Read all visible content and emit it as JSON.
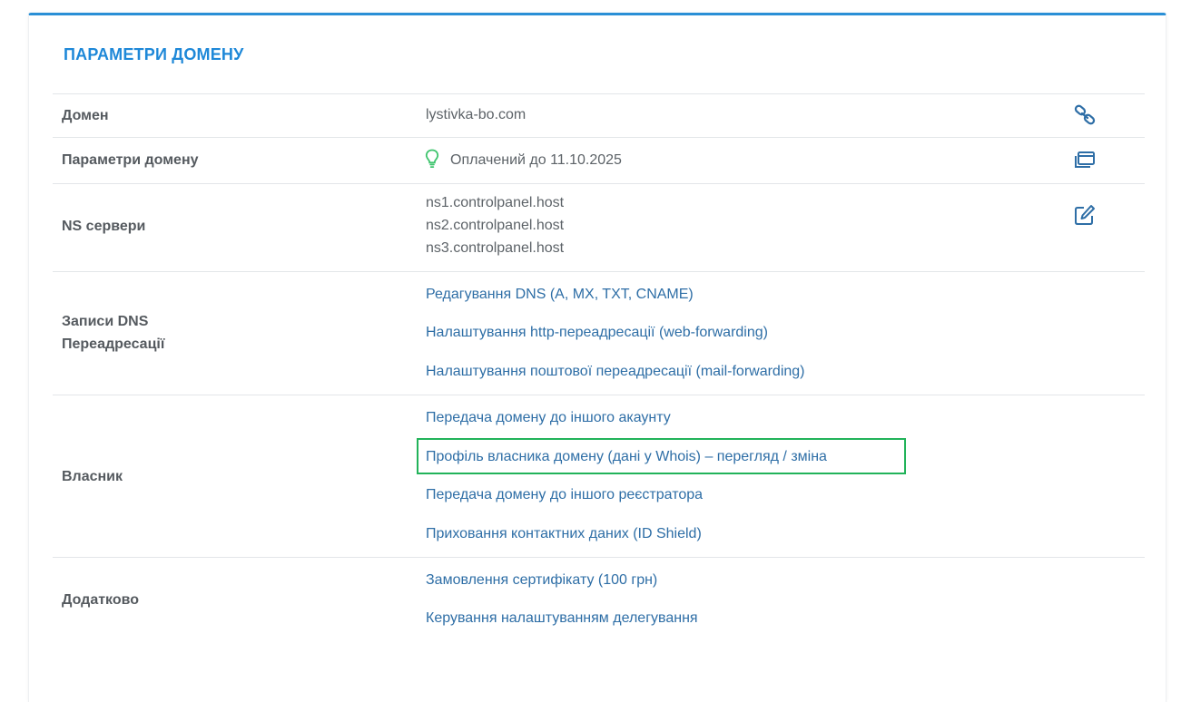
{
  "panel": {
    "title": "ПАРАМЕТРИ ДОМЕНУ"
  },
  "rows": {
    "domain": {
      "label": "Домен",
      "value": "lystivka-bo.com",
      "icon": "link-icon"
    },
    "params": {
      "label": "Параметри домену",
      "value": "Оплачений до 11.10.2025",
      "status_icon": "lightbulb-icon",
      "icon": "windows-icon"
    },
    "ns": {
      "label": "NS сервери",
      "servers": [
        "ns1.controlpanel.host",
        "ns2.controlpanel.host",
        "ns3.controlpanel.host"
      ],
      "icon": "edit-icon"
    },
    "dns": {
      "label_line1": "Записи DNS",
      "label_line2": "Переадресації",
      "links": [
        "Редагування DNS (A, MX, TXT, CNAME)",
        "Налаштування http-переадресації (web-forwarding)",
        "Налаштування поштової переадресації (mail-forwarding)"
      ]
    },
    "owner": {
      "label": "Власник",
      "links": [
        "Передача домену до іншого акаунту",
        "Профіль власника домену (дані у Whois) – перегляд / зміна",
        "Передача домену до іншого реєстратора",
        "Приховання контактних даних (ID Shield)"
      ]
    },
    "extra": {
      "label": "Додатково",
      "links": [
        "Замовлення сертифікату (100 грн)",
        "Керування налаштуванням делегування"
      ]
    }
  },
  "colors": {
    "accent": "#1e88d8",
    "link": "#2e6ea6",
    "highlight": "#22b35a",
    "bulb": "#3ec46d"
  }
}
